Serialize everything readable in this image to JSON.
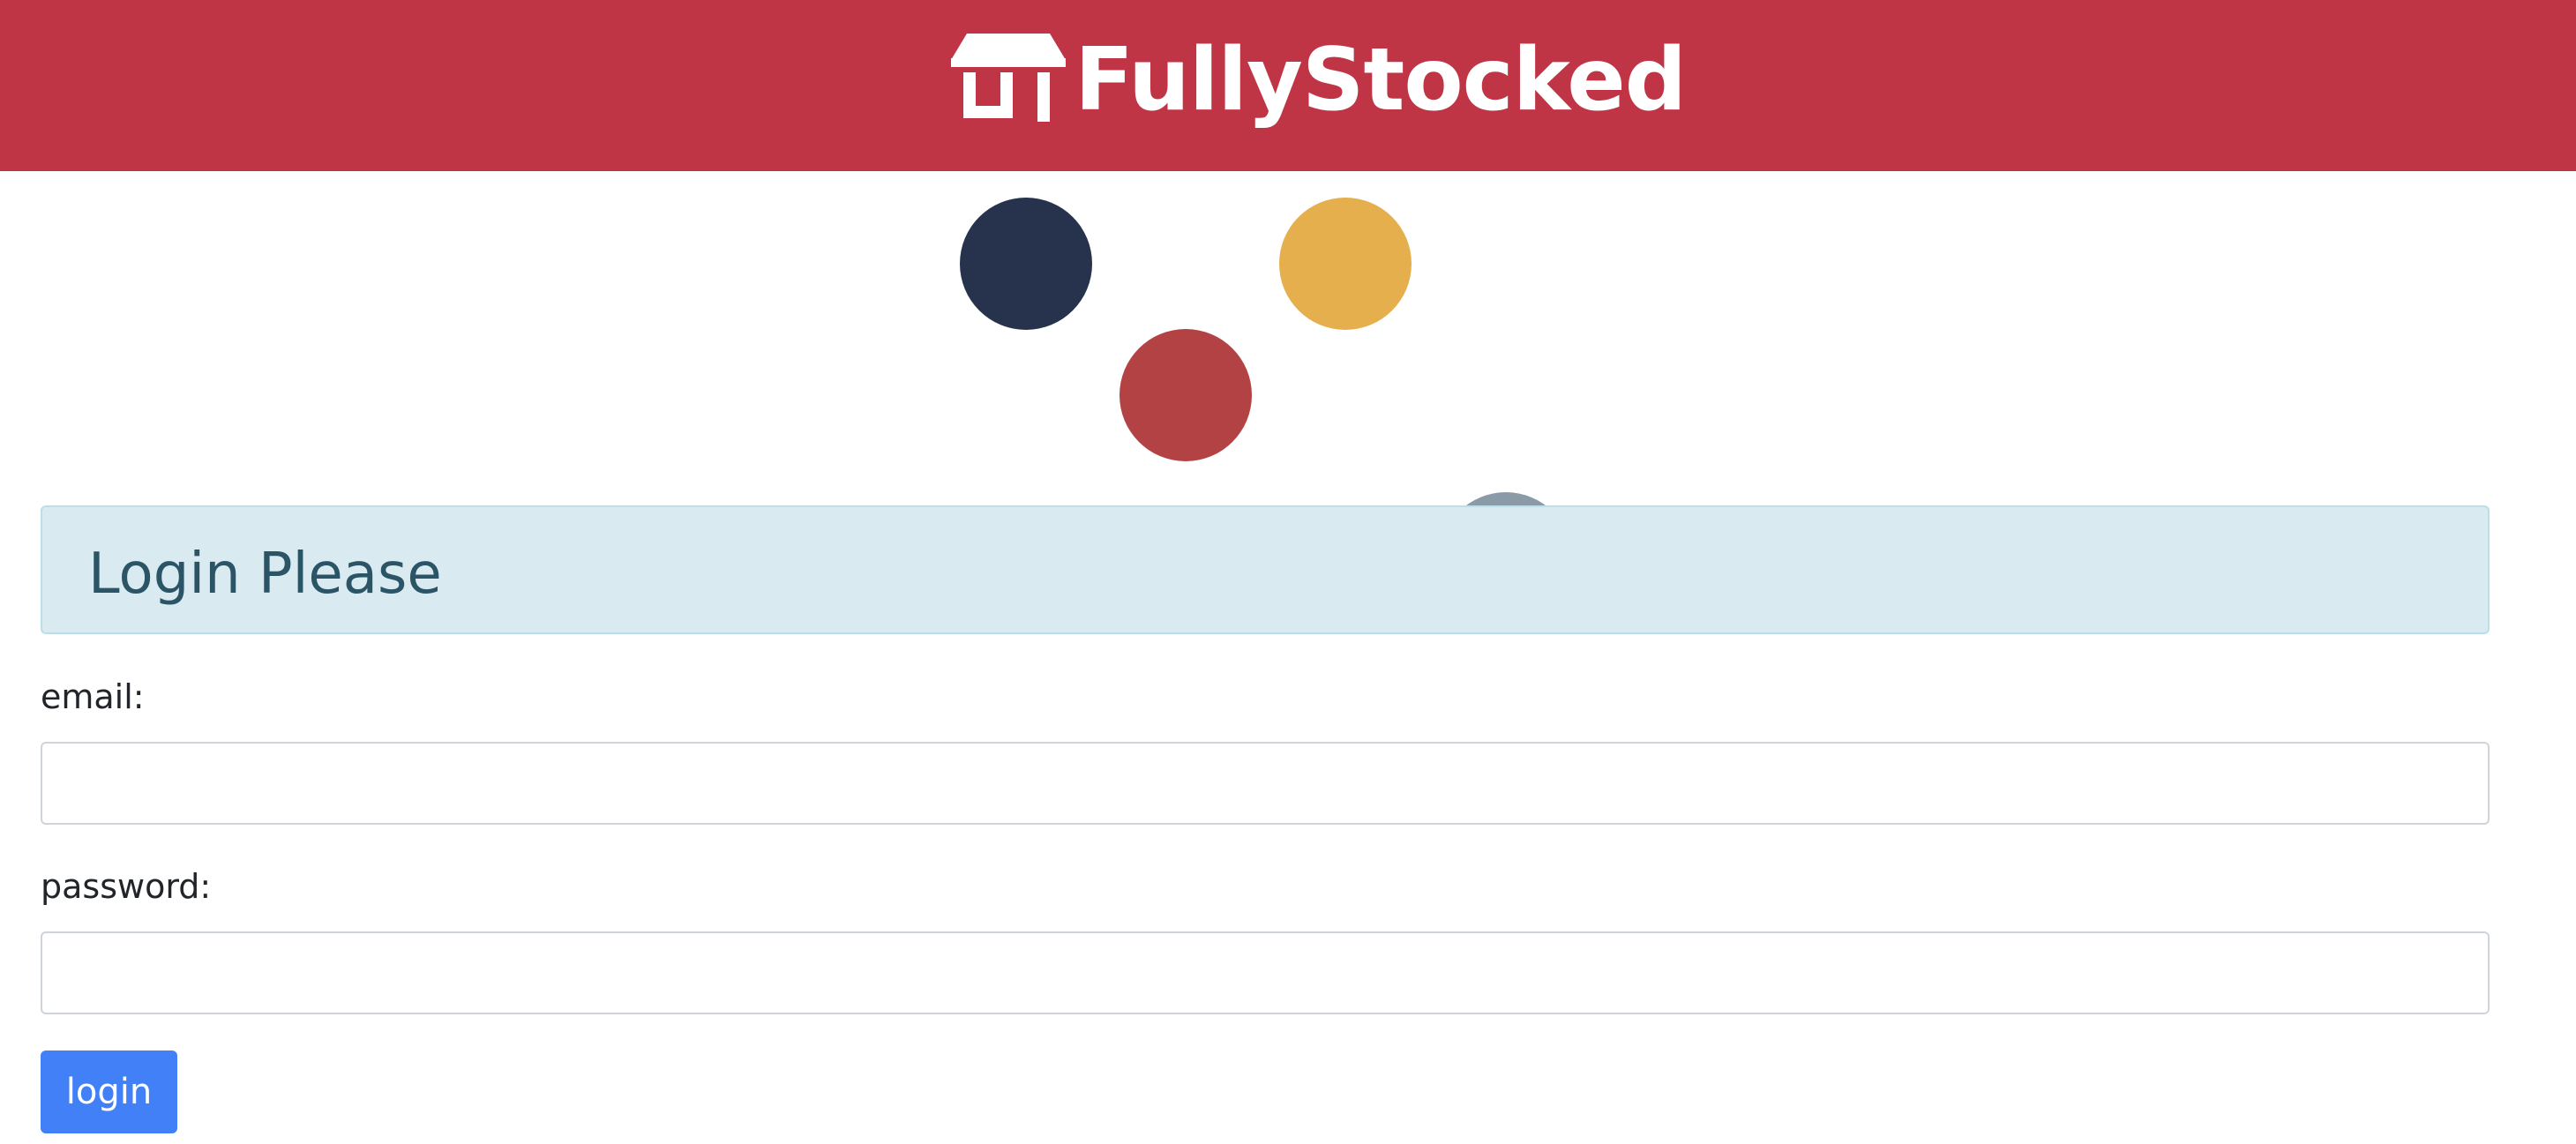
{
  "header": {
    "brand_name": "FullyStocked",
    "brand_icon": "storefront-icon",
    "background_color": "#c03546"
  },
  "decorations": {
    "dot_colors": [
      "#27334d",
      "#e4af4c",
      "#b34245",
      "#8a9aa7"
    ]
  },
  "login_form": {
    "title": "Login Please",
    "email_label": "email:",
    "email_value": "",
    "password_label": "password:",
    "password_value": "",
    "submit_label": "login",
    "submit_color": "#4280f8"
  }
}
